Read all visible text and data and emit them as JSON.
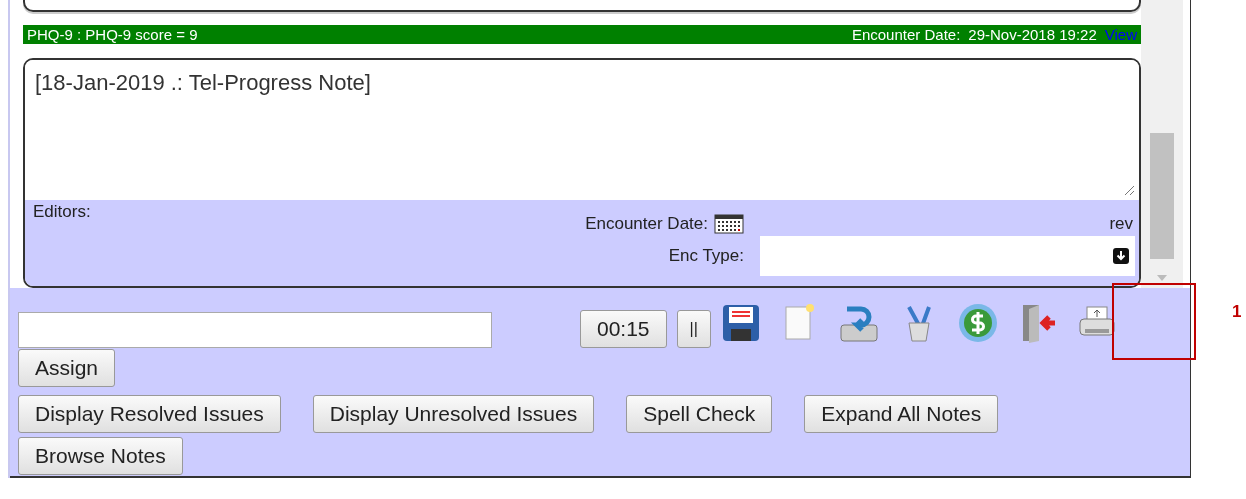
{
  "phq_bar": {
    "summary": "PHQ-9 : PHQ-9 score = 9",
    "encounter_label": "Encounter Date:",
    "encounter_value": "29-Nov-2018 19:22",
    "link": "View"
  },
  "note": {
    "text": "[18-Jan-2019 .: Tel-Progress Note]",
    "editors_label": "Editors:",
    "encounter_date_label": "Encounter Date:",
    "rev": "rev",
    "enc_type_label": "Enc Type:"
  },
  "toolbar": {
    "timer": "00:15",
    "pause": "||",
    "assign": "Assign"
  },
  "buttons": [
    "Display Resolved Issues",
    "Display Unresolved Issues",
    "Spell Check",
    "Expand All Notes",
    "Browse Notes"
  ],
  "annotation": {
    "label": "1"
  }
}
